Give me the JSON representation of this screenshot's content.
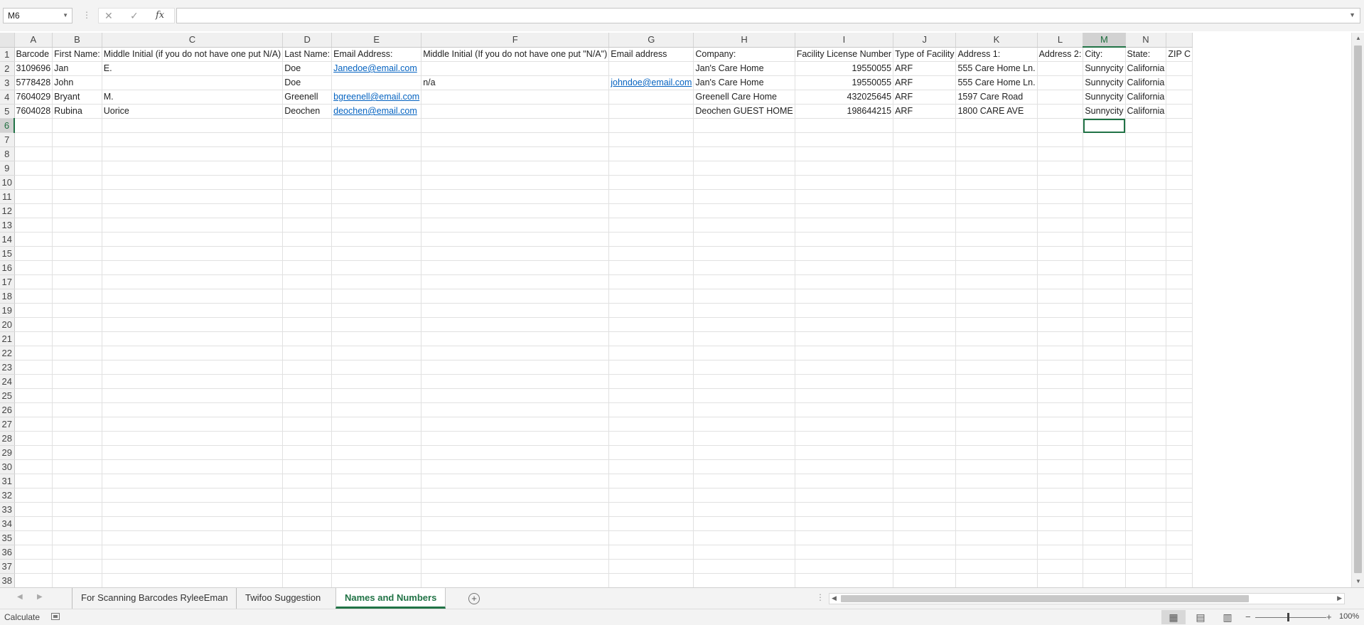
{
  "formula_bar": {
    "name_box": "M6",
    "cancel_icon": "✕",
    "enter_icon": "✓",
    "fx_icon": "fx",
    "formula": ""
  },
  "grid": {
    "columns": [
      "A",
      "B",
      "C",
      "D",
      "E",
      "F",
      "G",
      "H",
      "I",
      "J",
      "K",
      "L",
      "M",
      "N",
      ""
    ],
    "selected_column": "M",
    "selected_row": 6,
    "rows": [
      [
        "Barcode",
        "First Name:",
        "Middle Initial  (if you do not have one put N/A)",
        "Last Name:",
        "Email Address:",
        "Middle Initial (If you do not have one put \"N/A\")",
        "Email address",
        "Company:",
        "Facility License Number",
        "Type of Facility",
        "Address 1:",
        "Address 2:",
        "City:",
        "State:",
        "ZIP C"
      ],
      [
        "3109696",
        "Jan",
        "E.",
        "Doe",
        "Janedoe@email.com",
        "",
        "",
        "Jan's Care Home",
        "19550055",
        "ARF",
        "555 Care Home Ln.",
        "",
        "Sunnycity",
        "California",
        ""
      ],
      [
        "5778428",
        "John",
        "",
        "Doe",
        "",
        "n/a",
        "johndoe@email.com",
        "Jan's Care Home",
        "19550055",
        "ARF",
        "555 Care Home Ln.",
        "",
        "Sunnycity",
        "California",
        ""
      ],
      [
        "7604029",
        "Bryant",
        "M.",
        "Greenell",
        "bgreenell@email.com",
        "",
        "",
        "Greenell Care Home",
        "432025645",
        "ARF",
        "1597 Care Road",
        "",
        "Sunnycity",
        "California",
        ""
      ],
      [
        "7604028",
        "Rubina",
        "Uorice",
        "Deochen",
        "deochen@email.com",
        "",
        "",
        "Deochen GUEST HOME",
        "198644215",
        "ARF",
        "1800 CARE AVE",
        "",
        "Sunnycity",
        "California",
        ""
      ]
    ],
    "total_rows": 38
  },
  "sheets": {
    "tabs": [
      "For Scanning Barcodes RyleeEman",
      "Twifoo Suggestion",
      "Names and Numbers"
    ],
    "active": "Names and Numbers",
    "add_icon": "+"
  },
  "status_bar": {
    "mode": "Calculate",
    "zoom": "100%"
  }
}
